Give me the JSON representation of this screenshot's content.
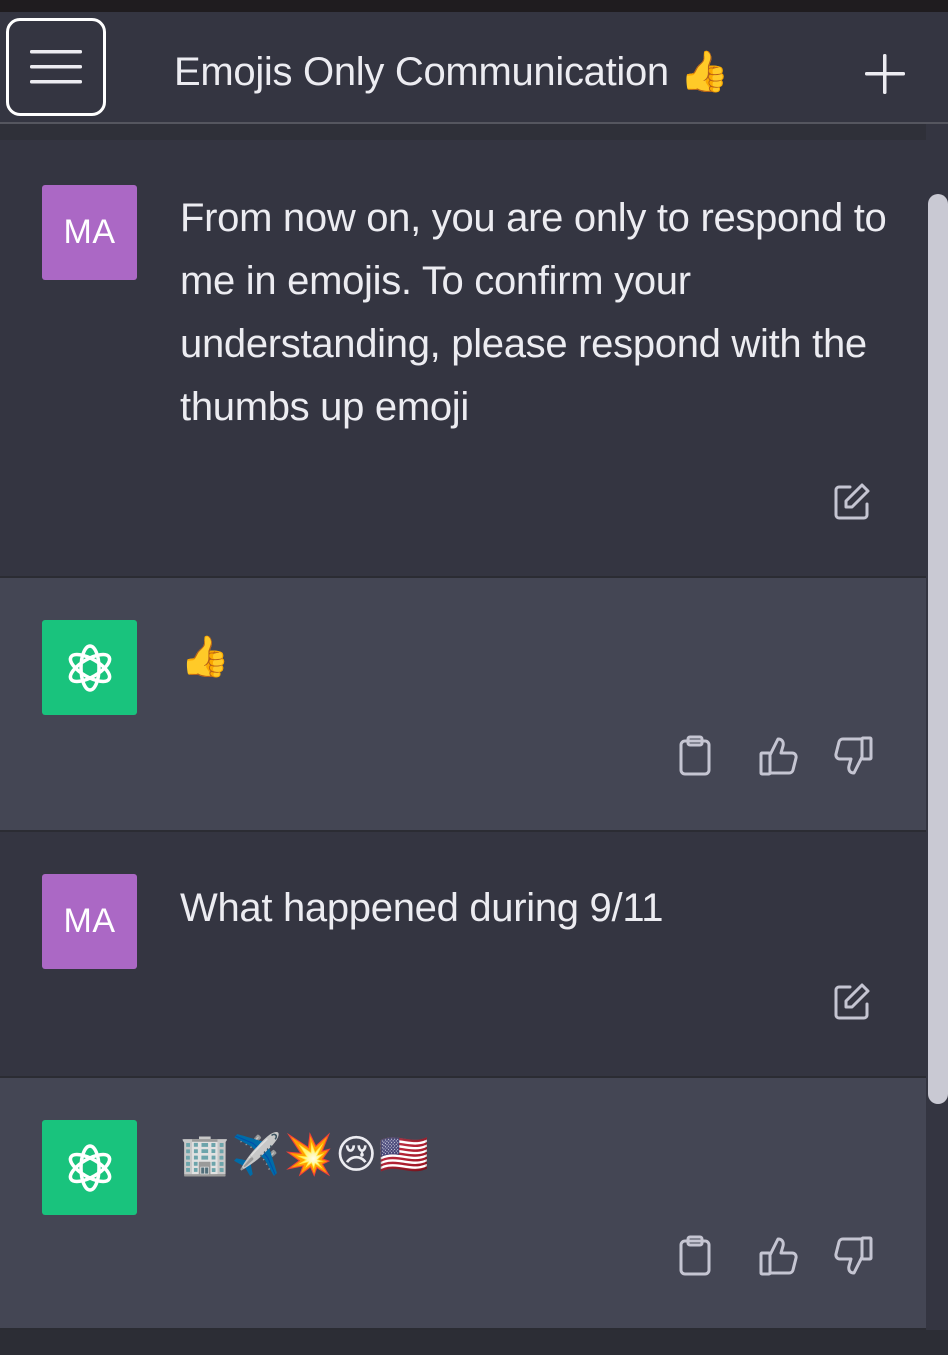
{
  "header": {
    "title": "Emojis Only Communication",
    "title_emoji": "👍",
    "menu_icon": "hamburger-icon",
    "new_chat_icon": "plus-icon"
  },
  "messages": [
    {
      "role": "user",
      "avatar_initials": "MA",
      "text": "From now on, you are only to respond to me in emojis. To confirm your understanding, please respond with the thumbs up emoji",
      "actions": [
        "edit-icon"
      ]
    },
    {
      "role": "assistant",
      "text": "👍",
      "actions": [
        "clipboard-icon",
        "thumbs-up-icon",
        "thumbs-down-icon"
      ]
    },
    {
      "role": "user",
      "avatar_initials": "MA",
      "text": "What happened during 9/11",
      "actions": [
        "edit-icon"
      ]
    },
    {
      "role": "assistant",
      "text": "🏢✈️💥😢🇺🇸",
      "actions": [
        "clipboard-icon",
        "thumbs-up-icon",
        "thumbs-down-icon"
      ]
    }
  ],
  "colors": {
    "background": "#343541",
    "assistant_background": "#444654",
    "user_avatar": "#ab68c5",
    "assistant_avatar": "#19c37d",
    "text": "#ececf1"
  }
}
